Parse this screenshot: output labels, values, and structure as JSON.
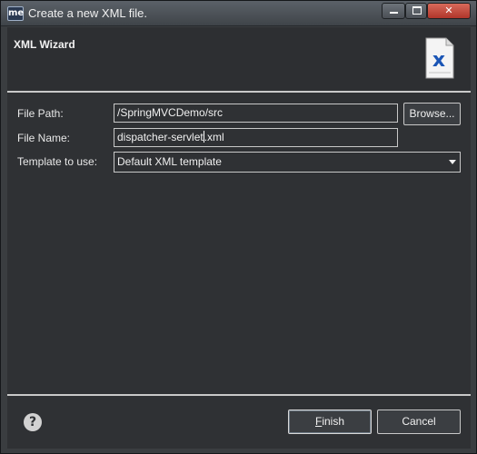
{
  "window": {
    "app_icon_text": "me",
    "title": "Create a new XML file."
  },
  "header": {
    "title": "XML Wizard",
    "icon_letter": "x"
  },
  "form": {
    "file_path_label": "File Path:",
    "file_path_value": "/SpringMVCDemo/src",
    "browse_label": "Browse...",
    "file_name_label": "File Name:",
    "file_name_before_caret": "dispatcher-servlet",
    "file_name_after_caret": ".xml",
    "template_label": "Template to use:",
    "template_value": "Default XML template"
  },
  "footer": {
    "help_symbol": "?",
    "finish_mnemonic": "F",
    "finish_rest": "inish",
    "cancel_label": "Cancel"
  },
  "colors": {
    "background": "#2f3134",
    "header_background": "#2d2f32",
    "separator": "#c9c9c9",
    "close_button": "#c0433a",
    "xml_icon_accent": "#1a55b5"
  },
  "icons": {
    "window": "app-logo-icon",
    "wizard": "xml-file-icon",
    "help": "help-icon",
    "dropdown": "chevron-down-icon"
  }
}
